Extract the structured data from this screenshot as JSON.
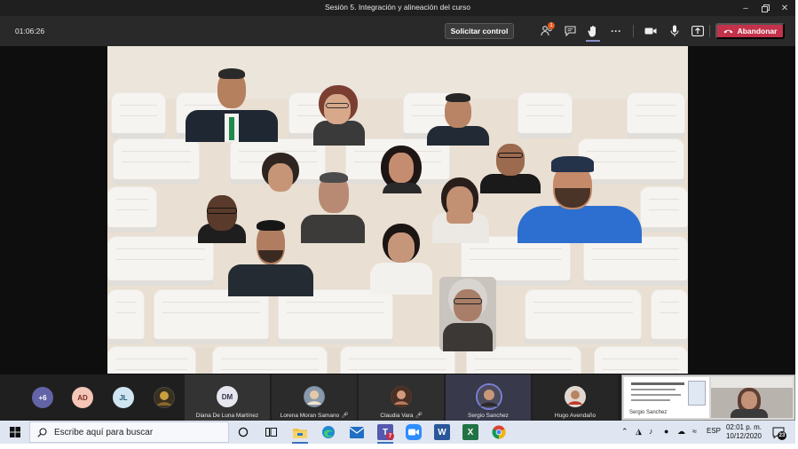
{
  "window": {
    "title": "Sesión 5. Integración y alineación del curso",
    "controls": [
      "minimize-icon",
      "restore-icon",
      "close-icon"
    ]
  },
  "toolbar": {
    "timer": "01:06:26",
    "request_control_label": "Solicitar control",
    "participants_badge": "1",
    "leave_label": "Abandonar",
    "icons": [
      "participants-icon",
      "chat-icon",
      "raise-hand-icon",
      "more-options-icon",
      "camera-icon",
      "microphone-icon",
      "share-screen-icon",
      "phone-hangup-icon"
    ]
  },
  "participants_strip": {
    "overflow_label": "+6",
    "avatars": [
      {
        "initials": "AD",
        "bg": "#f4c6b8",
        "fg": "#7a2e1d"
      },
      {
        "initials": "JL",
        "bg": "#cfe6f1",
        "fg": "#23587a"
      }
    ],
    "tiles": [
      {
        "name": "Diana De Luna Martínez",
        "initials": "DM",
        "type": "initials",
        "muted": false
      },
      {
        "name": "Lorena Moran Samano",
        "type": "photo",
        "muted": true
      },
      {
        "name": "Claudia Vara",
        "type": "photo",
        "muted": true
      },
      {
        "name": "Sergio Sanchez",
        "type": "photo",
        "muted": false
      },
      {
        "name": "Hugo Avendaño",
        "type": "photo",
        "muted": false
      }
    ],
    "preview_caption": "Sergio Sanchez"
  },
  "taskbar": {
    "search_placeholder": "Escribe aquí para buscar",
    "teams_badge": "7",
    "language": "ESP",
    "time": "02:01 p. m.",
    "date": "10/12/2020",
    "notifications_count": "23",
    "apps": [
      "task-view-icon",
      "file-explorer-icon",
      "edge-icon",
      "mail-icon",
      "teams-icon",
      "zoom-icon",
      "word-icon",
      "excel-icon",
      "chrome-icon"
    ]
  },
  "colors": {
    "leave_red": "#c4314b",
    "teams_dark": "#292929",
    "accent": "#6264a7"
  }
}
